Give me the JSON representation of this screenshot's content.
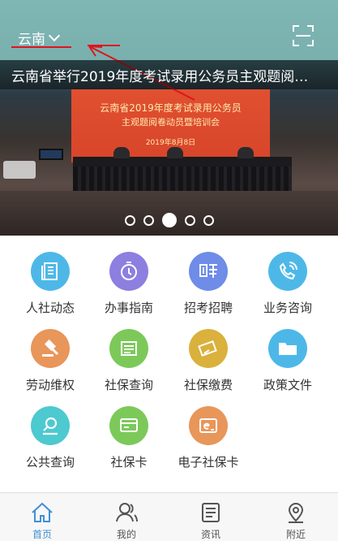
{
  "header": {
    "city": "云南",
    "chevron_icon": "chevron-down-icon",
    "scan_icon": "scan-icon"
  },
  "banner": {
    "title": "云南省举行2019年度考试录用公务员主观题阅…",
    "screen_line1": "云南省2019年度考试录用公务员",
    "screen_line2": "主观题阅卷动员暨培训会",
    "screen_line3": "2019年8月8日",
    "slides_total": 5,
    "active_slide": 3
  },
  "grid": {
    "items": [
      {
        "label": "人社动态",
        "icon": "news-icon",
        "color": "#4db8e8"
      },
      {
        "label": "办事指南",
        "icon": "stopwatch-icon",
        "color": "#8b7fe0"
      },
      {
        "label": "招考招聘",
        "icon": "recruit-icon",
        "color": "#6e8ce8"
      },
      {
        "label": "业务咨询",
        "icon": "phone-icon",
        "color": "#4db8e8"
      },
      {
        "label": "劳动维权",
        "icon": "gavel-icon",
        "color": "#e8965a"
      },
      {
        "label": "社保查询",
        "icon": "document-list-icon",
        "color": "#7cc95a"
      },
      {
        "label": "社保缴费",
        "icon": "card-payment-icon",
        "color": "#d9b13c"
      },
      {
        "label": "政策文件",
        "icon": "folder-icon",
        "color": "#4db8e8"
      },
      {
        "label": "公共查询",
        "icon": "search-icon",
        "color": "#4dc9d0"
      },
      {
        "label": "社保卡",
        "icon": "card-icon",
        "color": "#7cc95a"
      },
      {
        "label": "电子社保卡",
        "icon": "ecard-icon",
        "color": "#e8965a"
      }
    ]
  },
  "tabbar": {
    "tabs": [
      {
        "label": "首页",
        "icon": "home-icon",
        "active": true
      },
      {
        "label": "我的",
        "icon": "user-icon",
        "active": false
      },
      {
        "label": "资讯",
        "icon": "news-list-icon",
        "active": false
      },
      {
        "label": "附近",
        "icon": "location-icon",
        "active": false
      }
    ]
  },
  "colors": {
    "topbar": "#79b0ae",
    "accent": "#3f8fd6",
    "annotation": "#e0141b"
  }
}
